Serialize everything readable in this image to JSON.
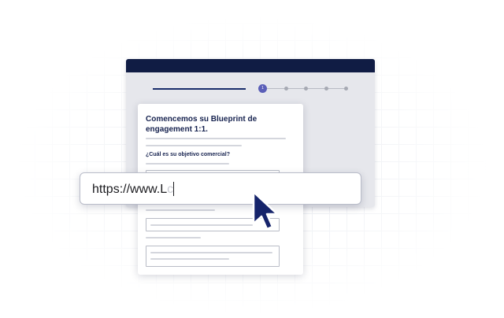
{
  "browser": {
    "bar_color": "#101c44",
    "stepper": {
      "active_step": 1,
      "total_steps": 5,
      "active_label": "1"
    }
  },
  "form": {
    "title": "Comencemos su Blueprint de engagement 1:1.",
    "question": "¿Cuál es su objetivo comercial?"
  },
  "url_bar": {
    "typed_text": "https://www.L",
    "ghost_text": "c"
  },
  "colors": {
    "accent": "#5b5fb8",
    "navy": "#16224f",
    "cursor": "#16246b"
  },
  "icons": {
    "cursor": "pointer-arrow-icon"
  }
}
